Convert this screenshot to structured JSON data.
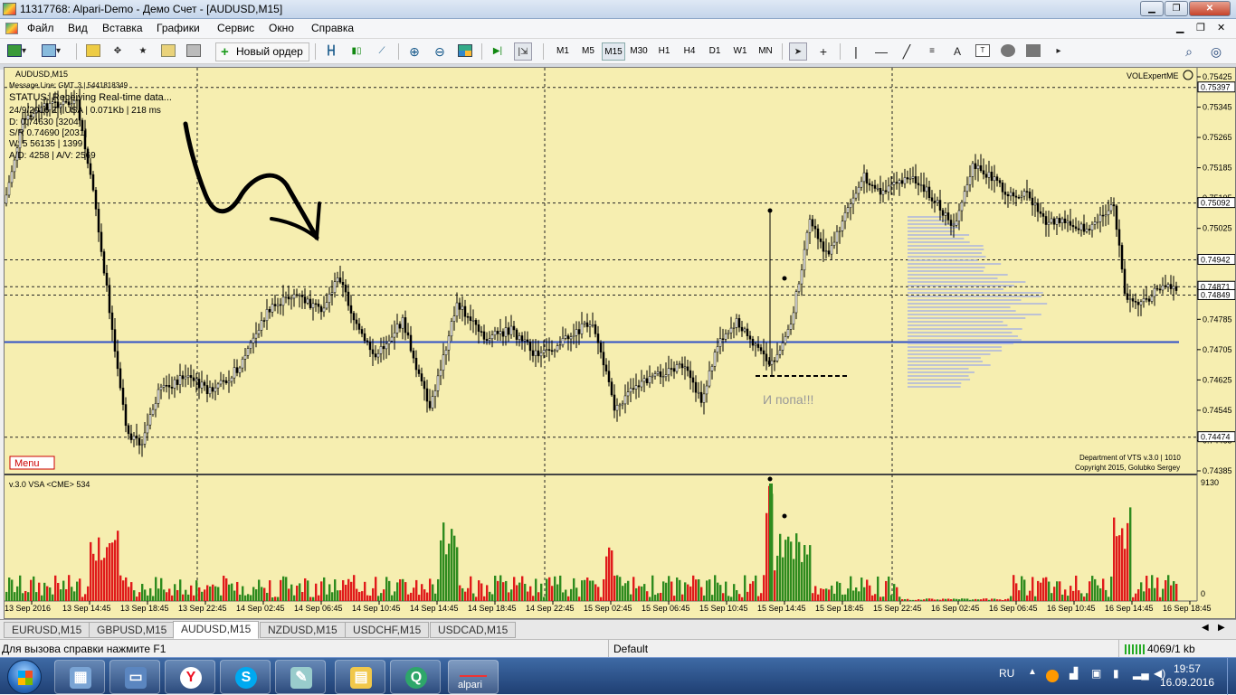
{
  "window": {
    "title": "11317768: Alpari-Demo - Демо Счет - [AUDUSD,M15]"
  },
  "menu": {
    "items": [
      "Файл",
      "Вид",
      "Вставка",
      "Графики",
      "Сервис",
      "Окно",
      "Справка"
    ]
  },
  "toolbar": {
    "new_order": "Новый ордер",
    "timeframes": [
      "M1",
      "M5",
      "M15",
      "M30",
      "H1",
      "H4",
      "D1",
      "W1",
      "MN"
    ],
    "active_timeframe": "M15"
  },
  "chart": {
    "symbol_label": "AUDUSD,M15",
    "expert_label": "VOLExpertME",
    "info_lines": [
      "Message Line: GMT. 3 | 5441818349",
      "STATUS: Receiving Real-time data...",
      "24/9/2016 Z | USA | 0.071Kb | 218 ms",
      "D: 0.74630 [3204]",
      "S/R 0.74690 [2031]",
      "W: 5 56135 | 1399",
      "A/D: 4258 | A/V: 2569"
    ],
    "annotation": "И попа!!!",
    "menu_button": "Menu",
    "copyright_lines": [
      "Department of VTS  v.3.0 | 1010",
      "Copyright 2015, Golubko Sergey"
    ],
    "volume_label": "v.3.0 VSA <CME> 534",
    "volume_axis": [
      "9130",
      "0"
    ],
    "price_ticks": [
      "0.75425",
      "0.75345",
      "0.75265",
      "0.75185",
      "0.75105",
      "0.75025",
      "0.74945",
      "0.74865",
      "0.74785",
      "0.74705",
      "0.74625",
      "0.74545",
      "0.74465",
      "0.74385"
    ],
    "price_markers": [
      {
        "price": 0.75397,
        "label": "0.75397"
      },
      {
        "price": 0.75092,
        "label": "0.75092"
      },
      {
        "price": 0.74942,
        "label": "0.74942"
      },
      {
        "price": 0.74871,
        "label": "0.74871"
      },
      {
        "price": 0.74849,
        "label": "0.74849"
      },
      {
        "price": 0.74474,
        "label": "0.74474"
      }
    ],
    "time_labels": [
      "13 Sep 2016",
      "13 Sep 14:45",
      "13 Sep 18:45",
      "13 Sep 22:45",
      "14 Sep 02:45",
      "14 Sep 06:45",
      "14 Sep 10:45",
      "14 Sep 14:45",
      "14 Sep 18:45",
      "14 Sep 22:45",
      "15 Sep 02:45",
      "15 Sep 06:45",
      "15 Sep 10:45",
      "15 Sep 14:45",
      "15 Sep 18:45",
      "15 Sep 22:45",
      "16 Sep 02:45",
      "16 Sep 06:45",
      "16 Sep 10:45",
      "16 Sep 14:45",
      "16 Sep 18:45"
    ],
    "support_level": 0.74725,
    "colors": {
      "background": "#f6eeb0",
      "bull": "#2e8b1e",
      "bear": "#e01a1a",
      "candle": "#000000",
      "level": "#3050c8"
    }
  },
  "tabs": {
    "items": [
      "EURUSD,M15",
      "GBPUSD,M15",
      "AUDUSD,M15",
      "NZDUSD,M15",
      "USDCHF,M15",
      "USDCAD,M15"
    ],
    "active": "AUDUSD,M15"
  },
  "status": {
    "help": "Для вызова справки нажмите F1",
    "profile": "Default",
    "traffic": "4069/1 kb"
  },
  "taskbar": {
    "lang": "RU",
    "time": "19:57",
    "date": "16.09.2016",
    "alpari_label": "alpari"
  }
}
